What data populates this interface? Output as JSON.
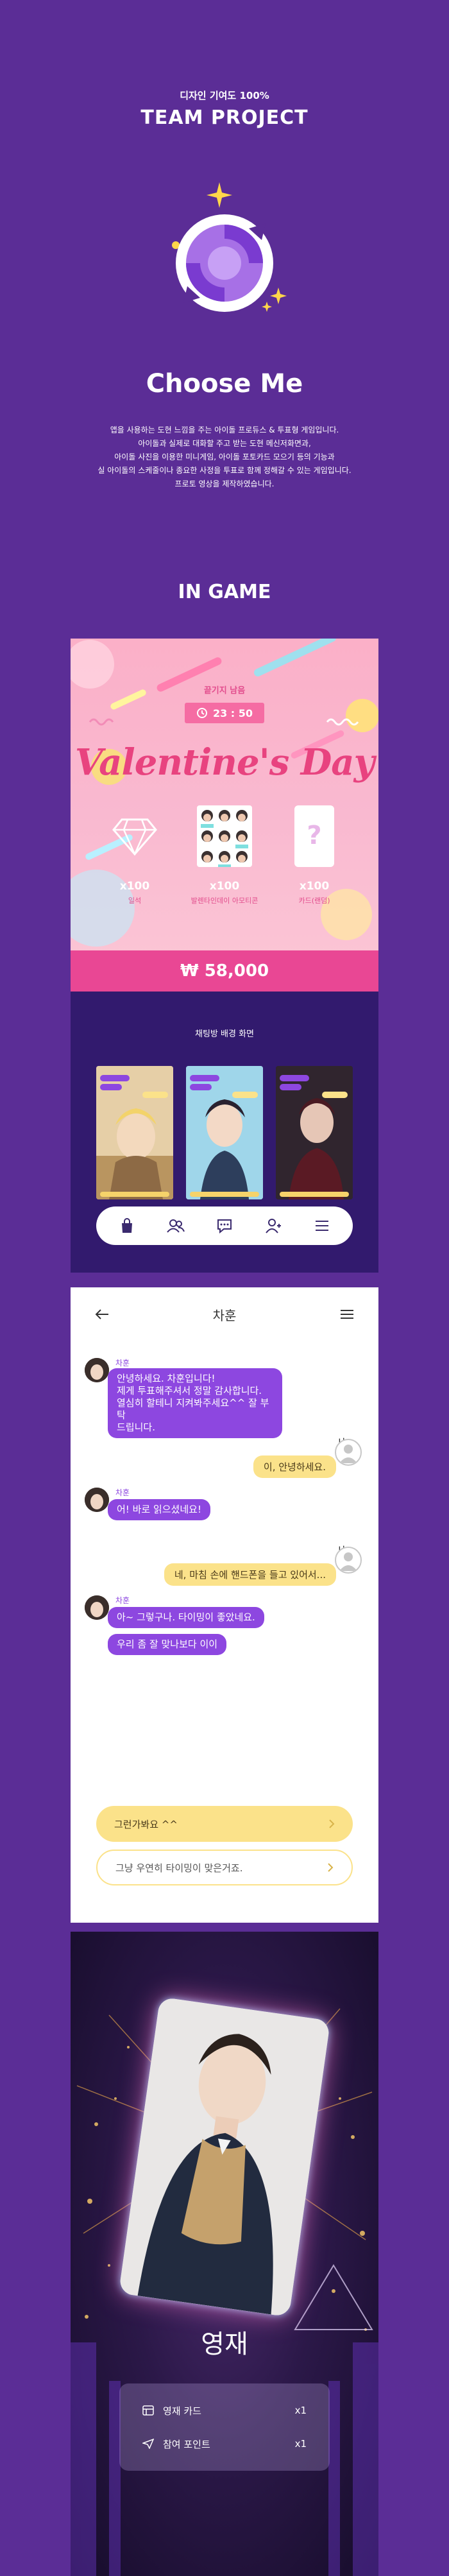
{
  "intro": {
    "subtitle": "디자인 기여도 100%",
    "title": "TEAM PROJECT",
    "choose_title": "Choose Me",
    "description": [
      "앱을 사용하는 도현 느낌을 주는 아이돌 프로듀스 & 투표형 게임입니다.",
      "아이돌과 실제로 대화할 주고 받는 도현 메신저화면과,",
      "아이돌 사진을 이용한 미니게임, 아이돌 포토카드 모으기 등의 기능과",
      "실 아이돌의 스케줄이나 종요한 사정을 투표로 함께 정해갈 수 있는 게임입니다.",
      "프로토 영상을 제작하였습니다."
    ],
    "ingame_label": "IN GAME"
  },
  "event_screen": {
    "remaining_label": "끝기지 남음",
    "timer": "23 : 50",
    "headline": "Valentine's Day",
    "items": [
      {
        "icon": "diamond-icon",
        "count": "x100",
        "name": "일석"
      },
      {
        "icon": "photocard-set-icon",
        "count": "x100",
        "name": "발렌타인데이 아모티콘"
      },
      {
        "icon": "mystery-card-icon",
        "count": "x100",
        "name": "카드(랜덤)"
      }
    ],
    "price": "₩ 58,000",
    "colors": {
      "accent": "#e94794",
      "timer": "#f56ca3"
    }
  },
  "background_screen": {
    "title": "채팅방 배경 화면",
    "thumbnails": [
      {
        "name": "chat-bg-yellow"
      },
      {
        "name": "chat-bg-blue"
      },
      {
        "name": "chat-bg-dark"
      }
    ],
    "nav": [
      "shop-bag-icon",
      "friends-icon",
      "chat-icon",
      "profile-icon",
      "menu-icon"
    ]
  },
  "chat_screen": {
    "title": "차훈",
    "messages": [
      {
        "from": "idol",
        "sender": "차훈",
        "text": [
          "안녕하세요. 차훈입니다!",
          "제게 투표해주셔서 정말 감사합니다.",
          "열심히 할테니 지켜봐주세요^^ 잘 부탁",
          "드립니다."
        ]
      },
      {
        "from": "me",
        "sender": "나",
        "text": "이, 안녕하세요."
      },
      {
        "from": "idol",
        "sender": "차훈",
        "text": "어! 바로 읽으셨네요!"
      },
      {
        "from": "me",
        "sender": "나",
        "text": "네, 마침 손에 핸드폰을 들고 있어서..."
      },
      {
        "from": "idol",
        "sender": "차훈",
        "text": [
          "아~ 그렇구나. 타이밍이 좋았네요.",
          "우리 좀 잘 맞나보다 이이"
        ]
      }
    ],
    "replies": [
      "그런가봐요 ^^",
      "그냥 우연히 타이밍이 맞은거죠."
    ]
  },
  "card_screen": {
    "idol_name": "영재",
    "rewards": [
      {
        "icon": "card-icon",
        "label": "영재 카드",
        "qty": "x1"
      },
      {
        "icon": "send-icon",
        "label": "참여 포인트",
        "qty": "x1"
      }
    ]
  }
}
